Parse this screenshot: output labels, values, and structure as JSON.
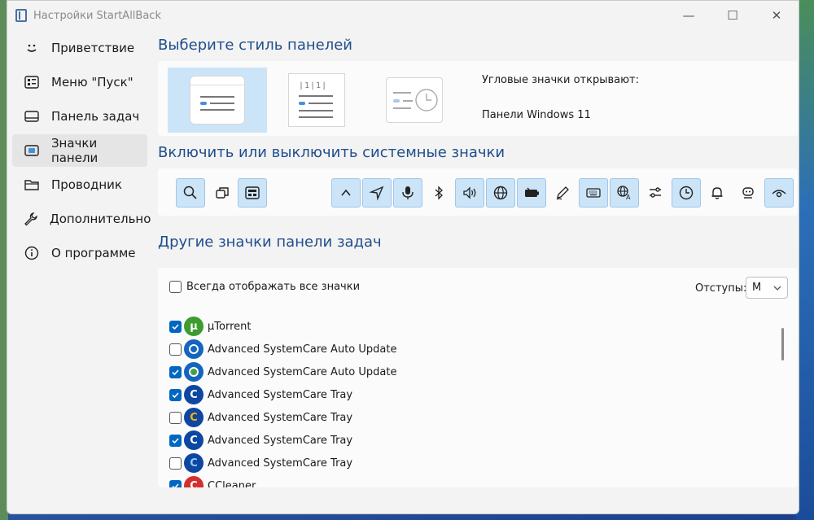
{
  "window": {
    "title": "Настройки StartAllBack",
    "minimize": "—",
    "maximize": "☐",
    "close": "✕"
  },
  "sidebar": {
    "items": [
      {
        "label": "Приветствие",
        "icon": "smiley-icon",
        "active": false
      },
      {
        "label": "Меню \"Пуск\"",
        "icon": "start-menu-icon",
        "active": false
      },
      {
        "label": "Панель задач",
        "icon": "taskbar-icon",
        "active": false
      },
      {
        "label": "Значки панели",
        "icon": "tray-icons-icon",
        "active": true
      },
      {
        "label": "Проводник",
        "icon": "folder-icon",
        "active": false
      },
      {
        "label": "Дополнительно",
        "icon": "wrench-icon",
        "active": false
      },
      {
        "label": "О программе",
        "icon": "info-icon",
        "active": false
      }
    ]
  },
  "main": {
    "style_section": {
      "title": "Выберите стиль панелей",
      "corner_label": "Угловые значки открывают:",
      "corner_value": "Панели Windows 11",
      "selected_option": 0
    },
    "system_icons_section": {
      "title": "Включить или выключить системные значки",
      "icons": [
        {
          "name": "search-icon",
          "on": true
        },
        {
          "name": "task-view-icon",
          "on": false
        },
        {
          "name": "widgets-icon",
          "on": true
        },
        {
          "name": "chevron-up-icon",
          "on": true
        },
        {
          "name": "location-icon",
          "on": true
        },
        {
          "name": "microphone-icon",
          "on": true
        },
        {
          "name": "bluetooth-icon",
          "on": false
        },
        {
          "name": "volume-icon",
          "on": true
        },
        {
          "name": "network-icon",
          "on": true
        },
        {
          "name": "battery-icon",
          "on": true
        },
        {
          "name": "pen-icon",
          "on": false
        },
        {
          "name": "keyboard-icon",
          "on": true
        },
        {
          "name": "language-icon",
          "on": true
        },
        {
          "name": "settings-sliders-icon",
          "on": false
        },
        {
          "name": "clock-icon",
          "on": true
        },
        {
          "name": "bell-icon",
          "on": false
        },
        {
          "name": "copilot-icon",
          "on": false
        },
        {
          "name": "eye-icon",
          "on": true
        }
      ]
    },
    "other_section": {
      "title": "Другие значки панели задач",
      "always_show_label": "Всегда отображать все значки",
      "always_show_checked": false,
      "spacing_label": "Отступы:",
      "spacing_value": "M",
      "apps": [
        {
          "name": "µTorrent",
          "checked": true,
          "color": "#3d9c2e"
        },
        {
          "name": "Advanced SystemCare Auto Update",
          "checked": false,
          "color": "#1565c0"
        },
        {
          "name": "Advanced SystemCare Auto Update",
          "checked": true,
          "color": "#1565c0"
        },
        {
          "name": "Advanced SystemCare Tray",
          "checked": true,
          "color": "#1565c0"
        },
        {
          "name": "Advanced SystemCare Tray",
          "checked": false,
          "color": "#1565c0"
        },
        {
          "name": "Advanced SystemCare Tray",
          "checked": true,
          "color": "#1565c0"
        },
        {
          "name": "Advanced SystemCare Tray",
          "checked": false,
          "color": "#1565c0"
        },
        {
          "name": "CCleaner",
          "checked": true,
          "color": "#d32f2f"
        }
      ]
    }
  },
  "colors": {
    "accent": "#0067c0",
    "heading": "#1f4e8c",
    "selected_bg": "#cce4f7"
  }
}
